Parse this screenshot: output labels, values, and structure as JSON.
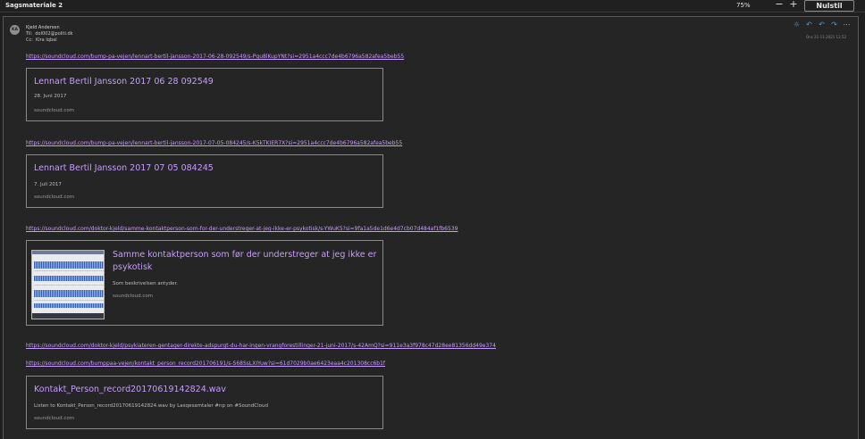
{
  "window": {
    "title": "Sagsmateriale 2",
    "zoom": "75%",
    "zoom_minus": "−",
    "zoom_plus": "+",
    "reset_label": "Nulstil"
  },
  "message": {
    "avatar_initials": "KA",
    "sender": "Kjeld Andersen",
    "to_label": "Til:",
    "to_value": "dol002@politi.dk",
    "cc_label": "Cc:",
    "cc_value": "Kira Iqbal",
    "date": "Ons 21-11-2021 12.52",
    "actions": [
      "sun-icon",
      "reply-icon",
      "reply-all-icon",
      "forward-icon",
      "more-icon"
    ]
  },
  "links": [
    "https://soundcloud.com/bump-pa-vejen/lennart-bertil-jansson-2017-06-28-092549/s-Pgu8lKupYNt?si=2951a4ccc7de4b6796a582afea5beb55",
    "https://soundcloud.com/bump-pa-vejen/lennart-bertil-jansson-2017-07-05-084245/s-K5kTKIER7X?si=2951a4ccc7de4b6796a582afea5beb55",
    "https://soundcloud.com/doktor-kjeld/samme-kontaktperson-som-for-der-understreger-at-jeg-ikke-er-psykotisk/s-YWuK5?si=9fa1a5de1d6e4d7cb07d484af1fb6539",
    "https://soundcloud.com/doktor-kjeld/psykiateren-gentager-direkte-adspurgt-du-har-ingen-vrangforestillinger-21-juni-2017/s-42AmQ?si=911e3a3f978c47d28ee81356dd49e374",
    "https://soundcloud.com/bumppaa-vejen/kontakt_person_record201706191/s-S68SsLXIYuw?si=61d7029b0ae6423eaa4c201308cc6b1f"
  ],
  "cards": [
    {
      "title": "Lennart Bertil Jansson 2017 06 28 092549",
      "sub": "28. Juni 2017",
      "domain": "soundcloud.com"
    },
    {
      "title": "Lennart Bertil Jansson 2017 07 05 084245",
      "sub": "7. Juli 2017",
      "domain": "soundcloud.com"
    },
    {
      "title_line1": "Samme kontaktperson som før der understreger at jeg ikke er",
      "title_line2": "psykotisk",
      "sub": "Som beskrivelsen antyder.",
      "domain": "soundcloud.com"
    },
    {
      "title": "Kontakt_Person_record20170619142824.wav",
      "sub": "Listen to Kontakt_Person_record20170619142824.wav by Lasqesamtaler #np on #SoundCloud",
      "domain": "soundcloud.com"
    }
  ]
}
